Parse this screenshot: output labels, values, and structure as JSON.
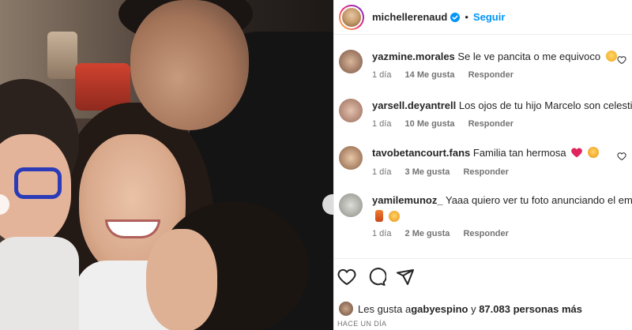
{
  "post_header": {
    "username": "michellerenaud",
    "separator": "•",
    "follow_label": "Seguir"
  },
  "comments": [
    {
      "username": "yazmine.morales",
      "text": "Se le ve pancita o me equivoco",
      "time": "1 día",
      "likes": "14 Me gusta",
      "reply": "Responder"
    },
    {
      "username": "yarsell.deyantrell",
      "text": "Los ojos de tu hijo Marcelo son celestia",
      "time": "1 día",
      "likes": "10 Me gusta",
      "reply": "Responder"
    },
    {
      "username": "tavobetancourt.fans",
      "text": "Familia tan hermosa",
      "time": "1 día",
      "likes": "3 Me gusta",
      "reply": "Responder"
    },
    {
      "username": "yamilemunoz_",
      "text": "Yaaa quiero ver tu foto anunciando el emb",
      "time": "1 día",
      "likes": "2 Me gusta",
      "reply": "Responder"
    }
  ],
  "likes_summary": {
    "prefix": "Les gusta a ",
    "user": "gabyespino",
    "middle": " y ",
    "count": "87.083 personas más"
  },
  "time_ago": "HACE UN DÍA",
  "icons": {
    "like": "heart-icon",
    "comment": "comment-icon",
    "share": "share-icon",
    "verified": "verified-badge-icon"
  },
  "colors": {
    "follow": "#0095f6",
    "verified": "#0095f6",
    "heart_emoji": "#e0245e"
  }
}
